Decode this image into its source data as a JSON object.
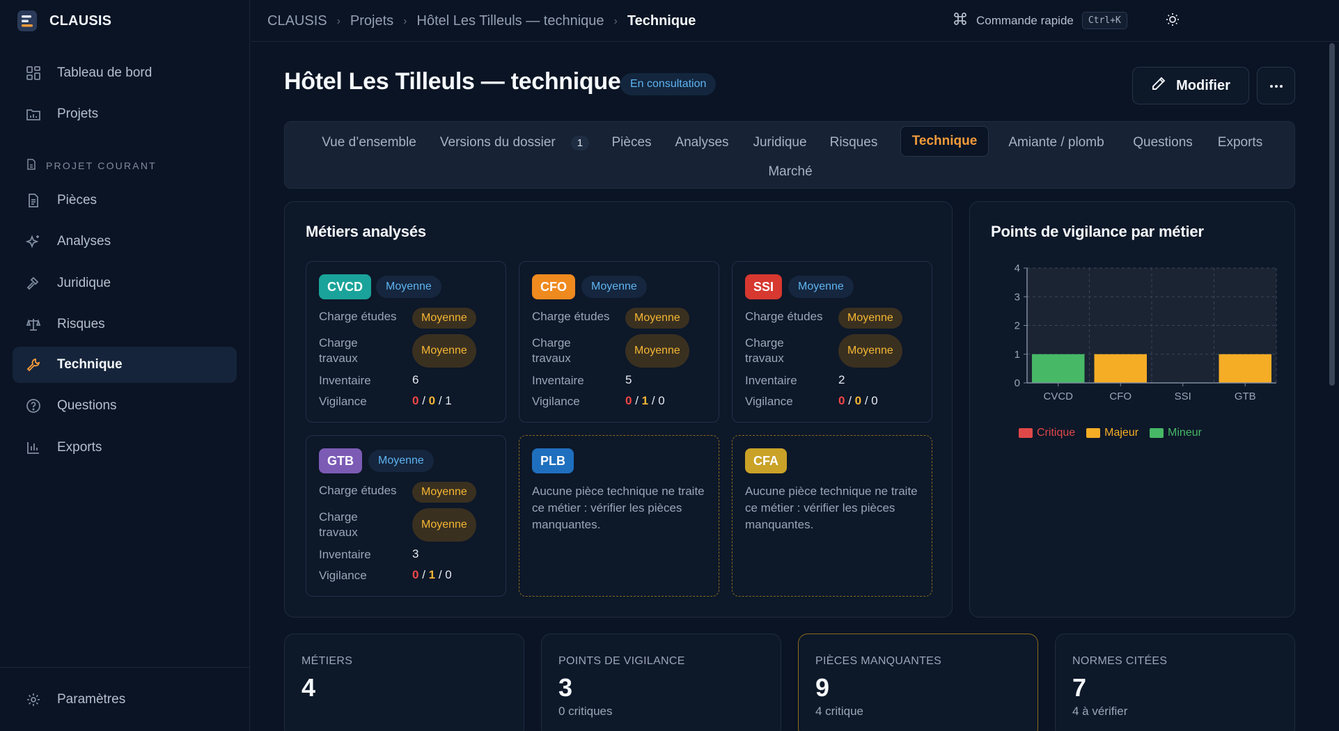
{
  "app": {
    "name": "CLAUSIS"
  },
  "sidebar": {
    "items": [
      {
        "label": "Tableau de bord"
      },
      {
        "label": "Projets"
      }
    ],
    "section_label": "PROJET COURANT",
    "project_items": [
      {
        "label": "Pièces"
      },
      {
        "label": "Analyses"
      },
      {
        "label": "Juridique"
      },
      {
        "label": "Risques"
      },
      {
        "label": "Technique"
      },
      {
        "label": "Questions"
      },
      {
        "label": "Exports"
      }
    ],
    "settings_label": "Paramètres"
  },
  "topbar": {
    "breadcrumbs": [
      "CLAUSIS",
      "Projets",
      "Hôtel Les Tilleuls — technique",
      "Technique"
    ],
    "quick_command": "Commande rapide",
    "shortcut": "Ctrl+K"
  },
  "page": {
    "title": "Hôtel Les Tilleuls — technique",
    "status": "En consultation",
    "modify_label": "Modifier"
  },
  "tabs": [
    {
      "label": "Vue d’ensemble"
    },
    {
      "label": "Versions du dossier",
      "count": "1"
    },
    {
      "label": "Pièces"
    },
    {
      "label": "Analyses"
    },
    {
      "label": "Juridique"
    },
    {
      "label": "Risques"
    },
    {
      "label": "Technique"
    },
    {
      "label": "Amiante / plomb"
    },
    {
      "label": "Questions"
    },
    {
      "label": "Exports"
    },
    {
      "label": "Marché"
    }
  ],
  "metiers": {
    "title": "Métiers analysés",
    "row_labels": {
      "etudes": "Charge études",
      "travaux": "Charge travaux",
      "inventaire": "Inventaire",
      "vigilance": "Vigilance"
    },
    "cards": [
      {
        "code": "CVCD",
        "color": "#1aa39a",
        "level": "Moyenne",
        "etudes": "Moyenne",
        "travaux": "Moyenne",
        "inventaire": "6",
        "vig_c": "0",
        "vig_m": "0",
        "vig_n": "1"
      },
      {
        "code": "CFO",
        "color": "#ef8a1f",
        "level": "Moyenne",
        "etudes": "Moyenne",
        "travaux": "Moyenne",
        "inventaire": "5",
        "vig_c": "0",
        "vig_m": "1",
        "vig_n": "0"
      },
      {
        "code": "SSI",
        "color": "#d7382f",
        "level": "Moyenne",
        "etudes": "Moyenne",
        "travaux": "Moyenne",
        "inventaire": "2",
        "vig_c": "0",
        "vig_m": "0",
        "vig_n": "0"
      },
      {
        "code": "GTB",
        "color": "#7c5bb5",
        "level": "Moyenne",
        "etudes": "Moyenne",
        "travaux": "Moyenne",
        "inventaire": "3",
        "vig_c": "0",
        "vig_m": "1",
        "vig_n": "0"
      }
    ],
    "empty_cards": [
      {
        "code": "PLB",
        "color": "#1f6fbf",
        "text": "Aucune pièce technique ne traite ce métier : vérifier les pièces manquantes."
      },
      {
        "code": "CFA",
        "color": "#c9a227",
        "text": "Aucune pièce technique ne traite ce métier : vérifier les pièces manquantes."
      }
    ]
  },
  "chart_data": {
    "type": "bar",
    "title": "Points de vigilance par métier",
    "categories": [
      "CVCD",
      "CFO",
      "SSI",
      "GTB"
    ],
    "series": [
      {
        "name": "Critique",
        "color": "#e04848",
        "values": [
          0,
          0,
          0,
          0
        ]
      },
      {
        "name": "Majeur",
        "color": "#f5ad26",
        "values": [
          0,
          1,
          0,
          1
        ]
      },
      {
        "name": "Mineur",
        "color": "#47b866",
        "values": [
          1,
          0,
          0,
          0
        ]
      }
    ],
    "ylim": [
      0,
      4
    ],
    "yticks": [
      "0",
      "1",
      "2",
      "3",
      "4"
    ],
    "grid": true,
    "legend": "bottom-left"
  },
  "stats": [
    {
      "label": "MÉTIERS",
      "value": "4",
      "sub": ""
    },
    {
      "label": "POINTS DE VIGILANCE",
      "value": "3",
      "sub": "0 critiques"
    },
    {
      "label": "PIÈCES MANQUANTES",
      "value": "9",
      "sub": "4 critique"
    },
    {
      "label": "NORMES CITÉES",
      "value": "7",
      "sub": "4 à vérifier"
    }
  ]
}
